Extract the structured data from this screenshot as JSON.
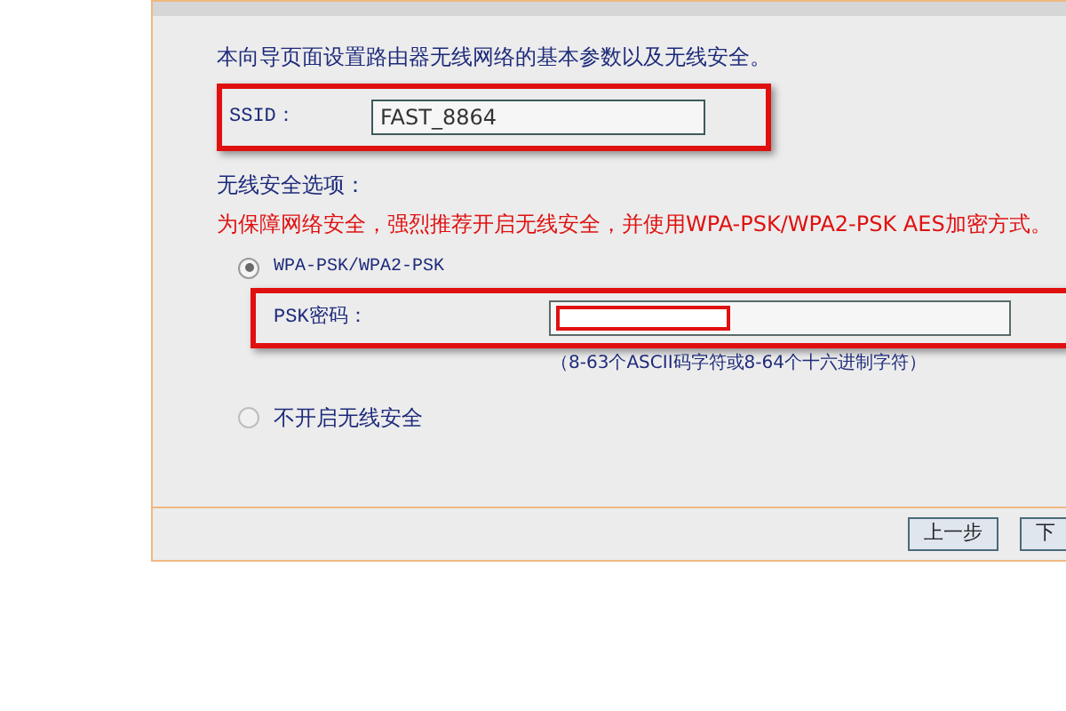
{
  "intro": "本向导页面设置路由器无线网络的基本参数以及无线安全。",
  "ssid": {
    "label": "SSID：",
    "value": "FAST_8864"
  },
  "security_heading": "无线安全选项：",
  "warning": "为保障网络安全，强烈推荐开启无线安全，并使用WPA-PSK/WPA2-PSK AES加密方式。",
  "options": [
    {
      "label": "WPA-PSK/WPA2-PSK",
      "selected": true
    },
    {
      "label": "不开启无线安全",
      "selected": false
    }
  ],
  "psk": {
    "label": "PSK密码：",
    "hint": "（8-63个ASCII码字符或8-64个十六进制字符）"
  },
  "buttons": [
    "上一步",
    "下"
  ]
}
